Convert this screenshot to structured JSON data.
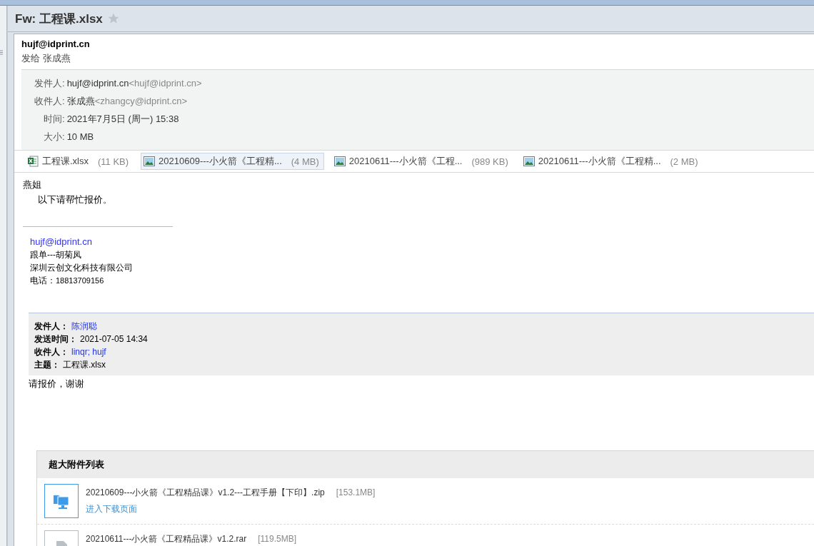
{
  "title": "Fw: 工程课.xlsx",
  "starred": false,
  "sender": "hujf@idprint.cn",
  "sent_to": "发给 张成燕",
  "details": [
    {
      "label": "发件人:",
      "value": "hujf@idprint.cn",
      "address": "<hujf@idprint.cn>"
    },
    {
      "label": "收件人:",
      "value": "张成燕",
      "address": "<zhangcy@idprint.cn>"
    },
    {
      "label": "时间:",
      "value": "2021年7月5日 (周一) 15:38"
    },
    {
      "label": "大小:",
      "value": "10 MB"
    }
  ],
  "attachments": [
    {
      "kind": "excel",
      "name": "工程课.xlsx",
      "size": "(11 KB)",
      "selected": false
    },
    {
      "kind": "image",
      "name": "20210609---小火箭《工程精...",
      "size": "(4 MB)",
      "selected": true
    },
    {
      "kind": "image",
      "name": "20210611---小火箭《工程...",
      "size": "(989 KB)",
      "selected": false
    },
    {
      "kind": "image",
      "name": "20210611---小火箭《工程精...",
      "size": "(2 MB)",
      "selected": false
    }
  ],
  "greeting": "燕姐",
  "body": "以下请帮忙报价。",
  "signature": {
    "email": "hujf@idprint.cn",
    "lines": [
      "跟单---胡菊凤",
      "深圳云创文化科技有限公司"
    ],
    "phone_label": "电话：",
    "phone": "18813709156"
  },
  "forwarded": [
    {
      "label": "发件人：",
      "value": "陈润聪",
      "kind": "link"
    },
    {
      "label": "发送时间：",
      "value": "2021-07-05 14:34",
      "kind": "text"
    },
    {
      "label": "收件人：",
      "value": "linqr; hujf",
      "kind": "link"
    },
    {
      "label": "主题：",
      "value": "工程课.xlsx",
      "kind": "text"
    }
  ],
  "forwarded_body": "请报价，谢谢",
  "big_attachments": {
    "title": "超大附件列表",
    "items": [
      {
        "kind": "computer",
        "name": "20210609---小火箭《工程精品课》v1.2---工程手册【下印】.zip",
        "size": "[153.1MB]",
        "link": "进入下载页面"
      },
      {
        "kind": "file",
        "name": "20210611---小火箭《工程精品课》v1.2.rar",
        "size": "[119.5MB]"
      }
    ]
  }
}
